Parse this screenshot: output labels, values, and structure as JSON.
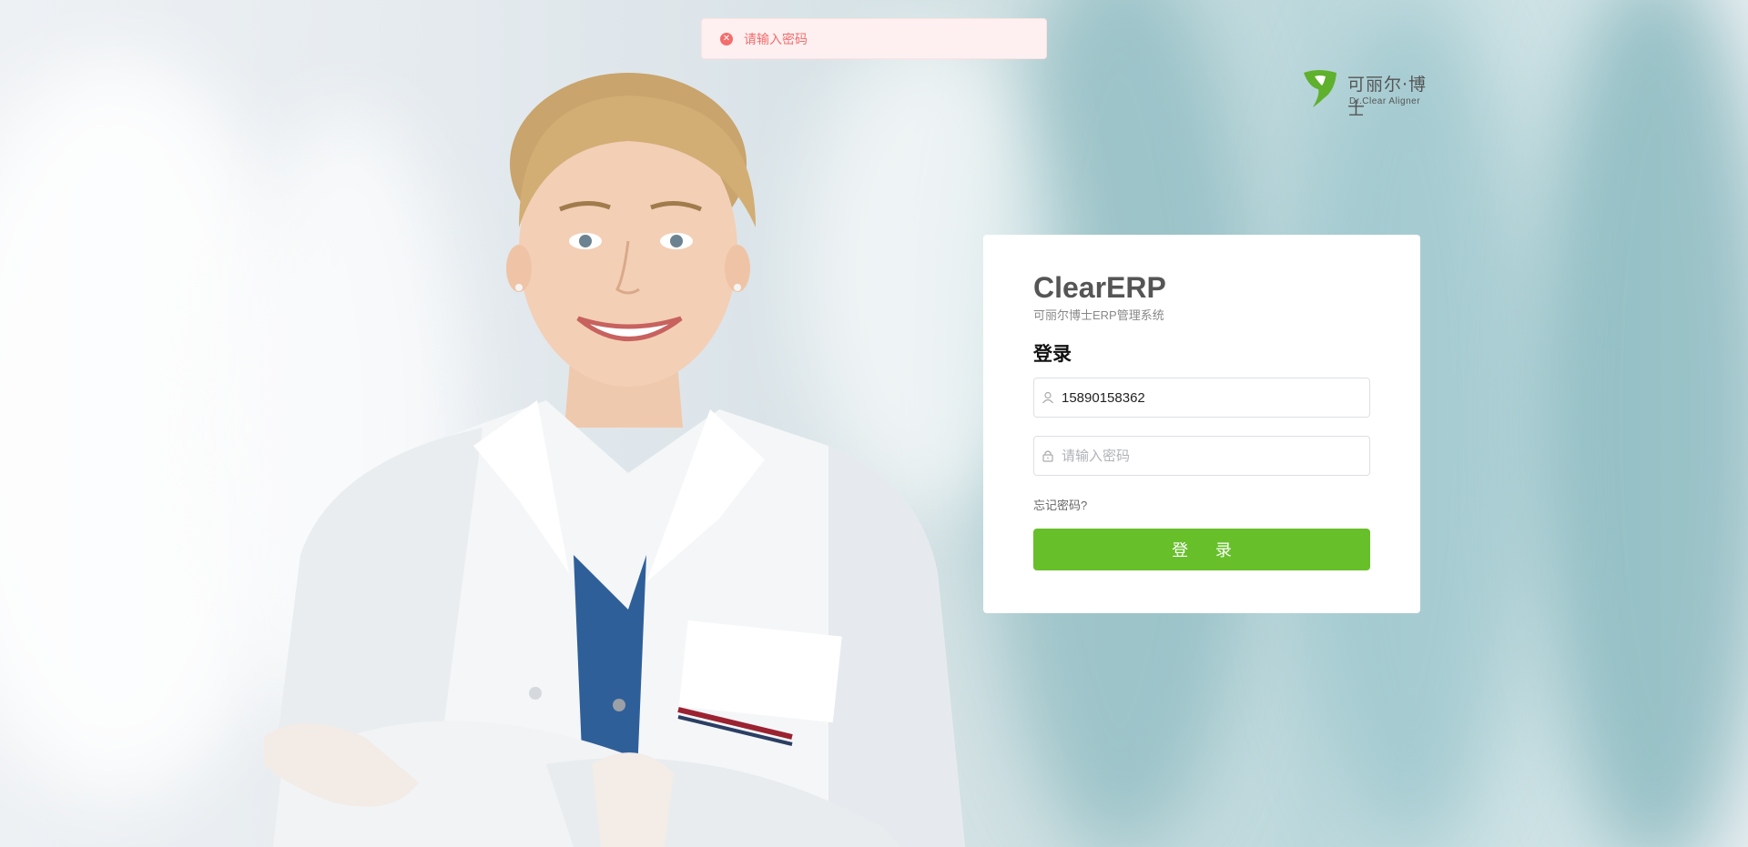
{
  "toast": {
    "message": "请输入密码",
    "icon": "error-circle-icon",
    "color": "#f56c6c"
  },
  "logo": {
    "name_cn": "可丽尔·博士",
    "name_en": "Dr.Clear Aligner",
    "color": "#5fb02d"
  },
  "card": {
    "title": "ClearERP",
    "subtitle": "可丽尔博士ERP管理系统",
    "heading": "登录",
    "username": {
      "value": "15890158362",
      "icon": "user-icon"
    },
    "password": {
      "value": "",
      "placeholder": "请输入密码",
      "icon": "lock-icon"
    },
    "forgot_label": "忘记密码?",
    "login_button": "登 录",
    "button_color": "#67bf2a"
  }
}
